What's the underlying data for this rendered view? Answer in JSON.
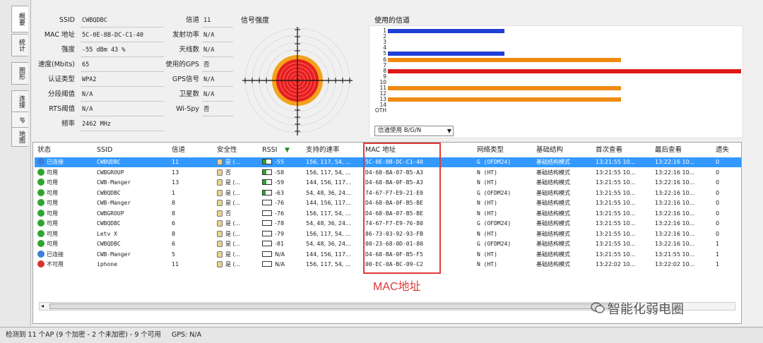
{
  "tabs": [
    "概要",
    "统计",
    "图形",
    "连接",
    "IP",
    "地图"
  ],
  "info": {
    "left": [
      {
        "label": "SSID",
        "value": "CWBQDBC"
      },
      {
        "label": "MAC 地址",
        "value": "5C-0E-8B-DC-C1-40"
      },
      {
        "label": "强度",
        "value": "-55 dBm      43 %"
      },
      {
        "label": "速度(Mbits)",
        "value": "65"
      },
      {
        "label": "认证类型",
        "value": "WPA2"
      },
      {
        "label": "分段阈值",
        "value": "N/A"
      },
      {
        "label": "RTS阈值",
        "value": "N/A"
      },
      {
        "label": "频率",
        "value": "2462 MHz"
      }
    ],
    "right": [
      {
        "label": "信道",
        "value": "11"
      },
      {
        "label": "发射功率",
        "value": "N/A"
      },
      {
        "label": "天线数",
        "value": "N/A"
      },
      {
        "label": "使用的GPS",
        "value": "否"
      },
      {
        "label": "GPS信号",
        "value": "N/A"
      },
      {
        "label": "卫星数",
        "value": "N/A"
      },
      {
        "label": "Wi-Spy",
        "value": "否"
      }
    ]
  },
  "signal": {
    "title": "信号强度"
  },
  "channels": {
    "title": "使用的信道",
    "labels": [
      "1",
      "2",
      "3",
      "4",
      "5",
      "6",
      "7",
      "8",
      "9",
      "10",
      "11",
      "12",
      "13",
      "14",
      "OTH"
    ],
    "bars": [
      {
        "channel": "1",
        "color": "#1f3fd6",
        "fraction": 0.33
      },
      {
        "channel": "5",
        "color": "#1f3fd6",
        "fraction": 0.33
      },
      {
        "channel": "6",
        "color": "#f08a12",
        "fraction": 0.66
      },
      {
        "channel": "8",
        "color": "#e01a1a",
        "fraction": 1.0
      },
      {
        "channel": "11",
        "color": "#f08a12",
        "fraction": 0.66
      },
      {
        "channel": "13",
        "color": "#f08a12",
        "fraction": 0.66
      }
    ],
    "select_value": "信道使用 B/G/N"
  },
  "table": {
    "headers": [
      "状态",
      "SSID",
      "信道",
      "安全性",
      "RSSI",
      "支持的速率",
      "MAC 地址",
      "网络类型",
      "基础结构",
      "首次查看",
      "最后查看",
      "遗失"
    ],
    "rows": [
      {
        "status": "已连接",
        "status_color": "#3b7fd8",
        "ssid": "CWBQDBC",
        "channel": "11",
        "secure": "是 (...",
        "rssi": "-55",
        "rssi_level": 0.43,
        "rates": "156, 117, 54, ...",
        "mac": "5C-0E-8B-DC-C1-40",
        "net": "G (OFDM24)",
        "infra": "基础结构模式",
        "first": "13:21:55 10...",
        "last": "13:22:16 10...",
        "lost": "0"
      },
      {
        "status": "可用",
        "status_color": "#2fa52f",
        "ssid": "CWBGROUP",
        "channel": "13",
        "secure": "否",
        "rssi": "-58",
        "rssi_level": 0.4,
        "rates": "156, 117, 54, ...",
        "mac": "D4-68-BA-07-B5-A3",
        "net": "N (HT)",
        "infra": "基础结构模式",
        "first": "13:21:55 10...",
        "last": "13:22:16 10...",
        "lost": "0"
      },
      {
        "status": "可用",
        "status_color": "#2fa52f",
        "ssid": "CWB-Manger",
        "channel": "13",
        "secure": "是 (...",
        "rssi": "-59",
        "rssi_level": 0.38,
        "rates": "144, 156, 117...",
        "mac": "D4-68-BA-0F-B5-A3",
        "net": "N (HT)",
        "infra": "基础结构模式",
        "first": "13:21:55 10...",
        "last": "13:22:16 10...",
        "lost": "0"
      },
      {
        "status": "可用",
        "status_color": "#2fa52f",
        "ssid": "CWBQDBC",
        "channel": "1",
        "secure": "是 (...",
        "rssi": "-63",
        "rssi_level": 0.33,
        "rates": "54, 48, 36, 24...",
        "mac": "74-67-F7-E9-21-E0",
        "net": "G (OFDM24)",
        "infra": "基础结构模式",
        "first": "13:21:55 10...",
        "last": "13:22:16 10...",
        "lost": "0"
      },
      {
        "status": "可用",
        "status_color": "#2fa52f",
        "ssid": "CWB-Manger",
        "channel": "8",
        "secure": "是 (...",
        "rssi": "-76",
        "rssi_level": 0.0,
        "rates": "144, 156, 117...",
        "mac": "D4-68-BA-0F-B5-BE",
        "net": "N (HT)",
        "infra": "基础结构模式",
        "first": "13:21:55 10...",
        "last": "13:22:16 10...",
        "lost": "0"
      },
      {
        "status": "可用",
        "status_color": "#2fa52f",
        "ssid": "CWBGROUP",
        "channel": "8",
        "secure": "否",
        "rssi": "-76",
        "rssi_level": 0.0,
        "rates": "156, 117, 54, ...",
        "mac": "D4-68-BA-07-B5-BE",
        "net": "N (HT)",
        "infra": "基础结构模式",
        "first": "13:21:55 10...",
        "last": "13:22:16 10...",
        "lost": "0"
      },
      {
        "status": "可用",
        "status_color": "#2fa52f",
        "ssid": "CWBQDBC",
        "channel": "6",
        "secure": "是 (...",
        "rssi": "-78",
        "rssi_level": 0.0,
        "rates": "54, 48, 36, 24...",
        "mac": "74-67-F7-E9-76-80",
        "net": "G (OFDM24)",
        "infra": "基础结构模式",
        "first": "13:21:55 10...",
        "last": "13:22:16 10...",
        "lost": "0"
      },
      {
        "status": "可用",
        "status_color": "#2fa52f",
        "ssid": "Letv X",
        "channel": "8",
        "secure": "是 (...",
        "rssi": "-79",
        "rssi_level": 0.0,
        "rates": "156, 117, 54, ...",
        "mac": "86-73-03-92-93-FB",
        "net": "N (HT)",
        "infra": "基础结构模式",
        "first": "13:21:55 10...",
        "last": "13:22:16 10...",
        "lost": "0"
      },
      {
        "status": "可用",
        "status_color": "#2fa52f",
        "ssid": "CWBQDBC",
        "channel": "6",
        "secure": "是 (...",
        "rssi": "-81",
        "rssi_level": 0.0,
        "rates": "54, 48, 36, 24...",
        "mac": "00-23-68-0D-01-80",
        "net": "G (OFDM24)",
        "infra": "基础结构模式",
        "first": "13:21:55 10...",
        "last": "13:22:16 10...",
        "lost": "1"
      },
      {
        "status": "已连接",
        "status_color": "#3b7fd8",
        "ssid": "CWB-Manger",
        "channel": "5",
        "secure": "是 (...",
        "rssi": "N/A",
        "rssi_level": 0.0,
        "rates": "144, 156, 117...",
        "mac": "D4-68-BA-0F-B5-F5",
        "net": "N (HT)",
        "infra": "基础结构模式",
        "first": "13:21:55 10...",
        "last": "13:21:55 10...",
        "lost": "1"
      },
      {
        "status": "不可用",
        "status_color": "#d93030",
        "ssid": "iphone",
        "channel": "11",
        "secure": "是 (...",
        "rssi": "N/A",
        "rssi_level": 0.0,
        "rates": "156, 117, 54, ...",
        "mac": "00-EC-0A-BC-09-C2",
        "net": "N (HT)",
        "infra": "基础结构模式",
        "first": "13:22:02 10...",
        "last": "13:22:02 10...",
        "lost": "1"
      }
    ]
  },
  "annotation": "MAC地址",
  "watermark": "智能化弱电圈",
  "status_bar": {
    "detected": "检测到 11 个AP (9 个加密 - 2 个未加密) - 9 个可用",
    "gps": "GPS: N/A"
  }
}
